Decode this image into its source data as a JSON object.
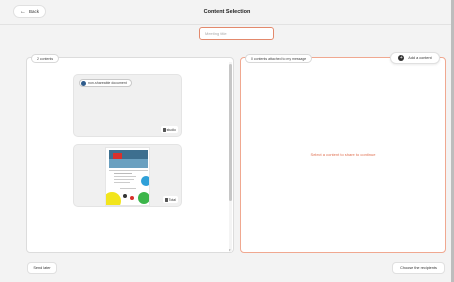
{
  "header": {
    "back_label": "Back",
    "title": "Content Selection"
  },
  "title_input": {
    "placeholder": "Meeting title",
    "value": ""
  },
  "left_panel": {
    "count_label": "2 contents",
    "cards": [
      {
        "name": "non-shareable document",
        "tag": "studio"
      },
      {
        "name": "",
        "tag": "Total"
      }
    ]
  },
  "right_panel": {
    "count_label": "0 contents attached to my message",
    "add_button_label": "Add a content",
    "empty_message": "Select a content to share to continue"
  },
  "footer": {
    "send_later_label": "Send later",
    "choose_recipients_label": "Choose the recipients"
  },
  "colors": {
    "accent": "#e3896c",
    "empty_text": "#e07050",
    "doc_dot": "#2f5c8c"
  }
}
